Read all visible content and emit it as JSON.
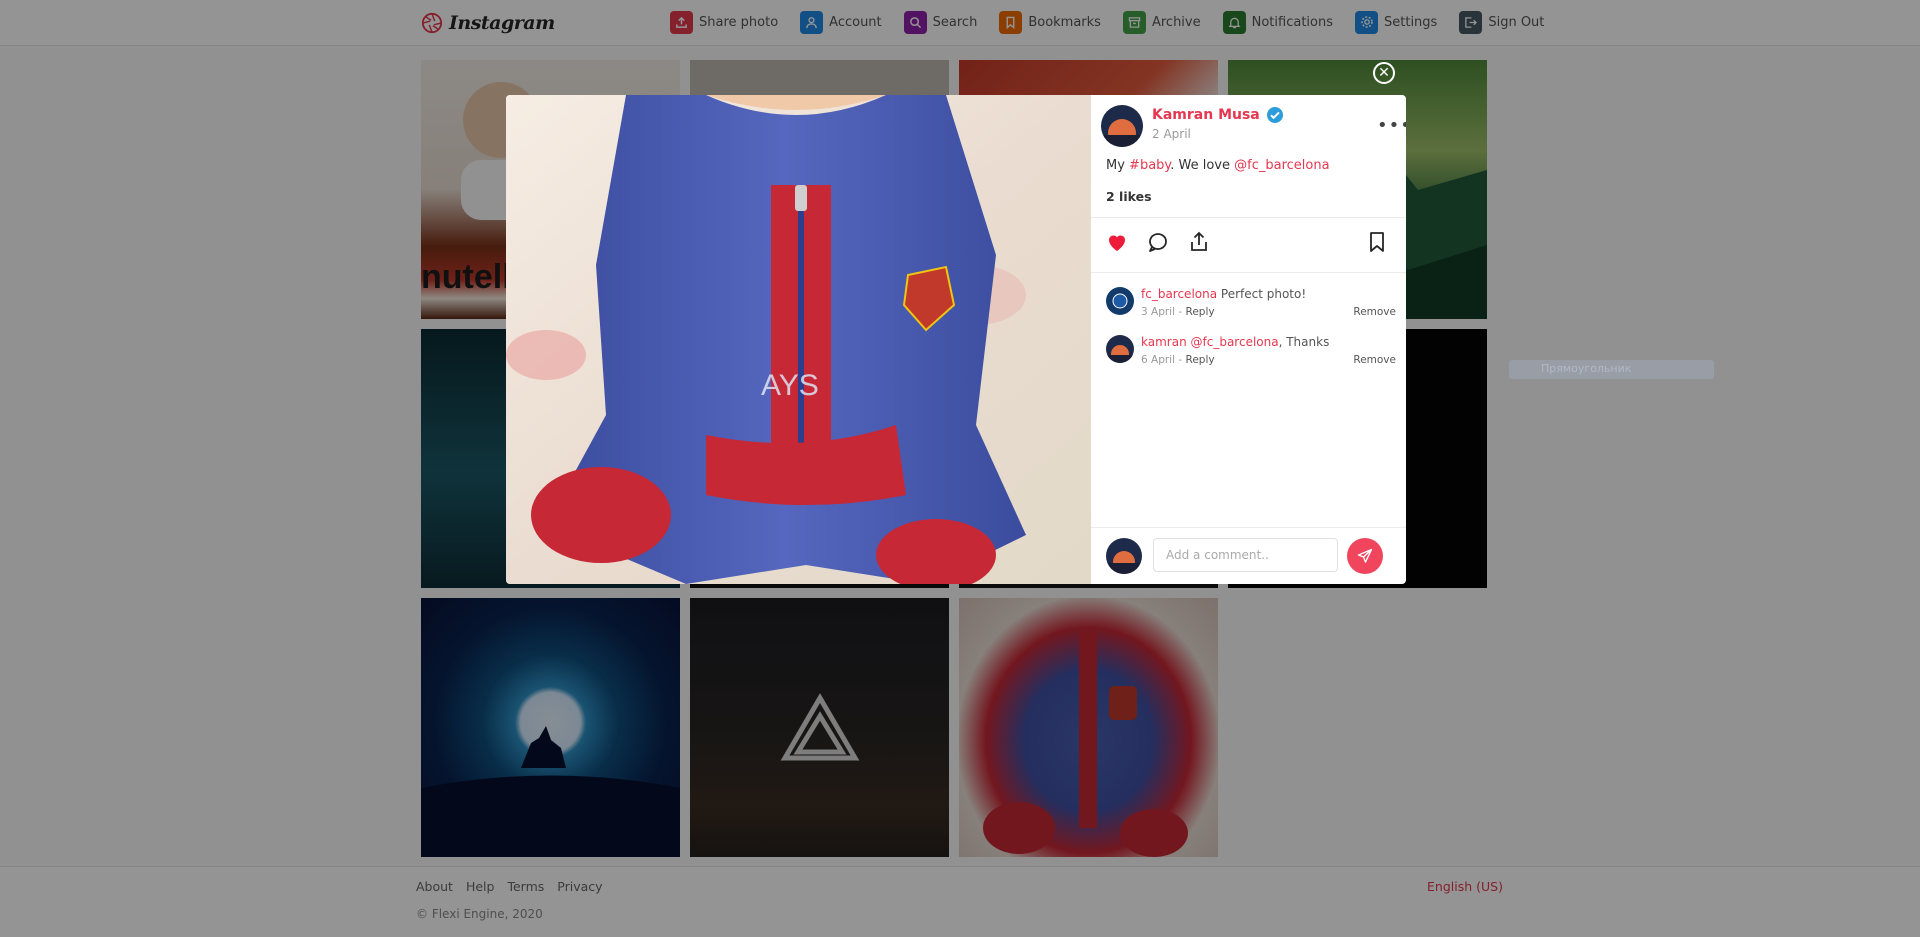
{
  "header": {
    "logo_text": "Instagram",
    "nav": [
      {
        "label": "Share photo",
        "icon": "share-photo-icon",
        "color": "#e5374f"
      },
      {
        "label": "Account",
        "icon": "account-icon",
        "color": "#1e88e5"
      },
      {
        "label": "Search",
        "icon": "search-icon",
        "color": "#8e24aa"
      },
      {
        "label": "Bookmarks",
        "icon": "bookmark-icon",
        "color": "#ef6c00"
      },
      {
        "label": "Archive",
        "icon": "archive-icon",
        "color": "#43a047"
      },
      {
        "label": "Notifications",
        "icon": "bell-icon",
        "color": "#2e7d32"
      },
      {
        "label": "Settings",
        "icon": "gear-icon",
        "color": "#1e88e5"
      },
      {
        "label": "Sign Out",
        "icon": "sign-out-icon",
        "color": "#455a64"
      }
    ]
  },
  "grid": {
    "tiles": [
      "baby-nutella-photo",
      "blanket-photo",
      "tomato-photo",
      "green-mountains-photo",
      "teal-photo",
      "dark-photo",
      "dark-photo-2",
      "black-photo",
      "wolf-moon-photo",
      "triangle-logo-photo",
      "baby-barcelona-photo"
    ]
  },
  "ghost": {
    "label": "Прямоугольник"
  },
  "modal": {
    "author": "Kamran Musa",
    "date": "2 April",
    "caption": {
      "prefix": "My ",
      "hashtag": "#baby",
      "middle": ". We love ",
      "mention": "@fc_barcelona"
    },
    "likes": "2 likes",
    "comments": [
      {
        "user": "fc_barcelona",
        "mention": "",
        "text": " Perfect photo!",
        "date": "3 April",
        "reply": "Reply",
        "remove": "Remove"
      },
      {
        "user": "kamran",
        "mention": " @fc_barcelona",
        "text": ", Thanks",
        "date": "6 April",
        "reply": "Reply",
        "remove": "Remove"
      }
    ],
    "comment_placeholder": "Add a comment..",
    "like_color": "#ed1c3b"
  },
  "footer": {
    "links": [
      "About",
      "Help",
      "Terms",
      "Privacy"
    ],
    "language": "English (US)",
    "copyright": "© Flexi Engine, 2020"
  }
}
